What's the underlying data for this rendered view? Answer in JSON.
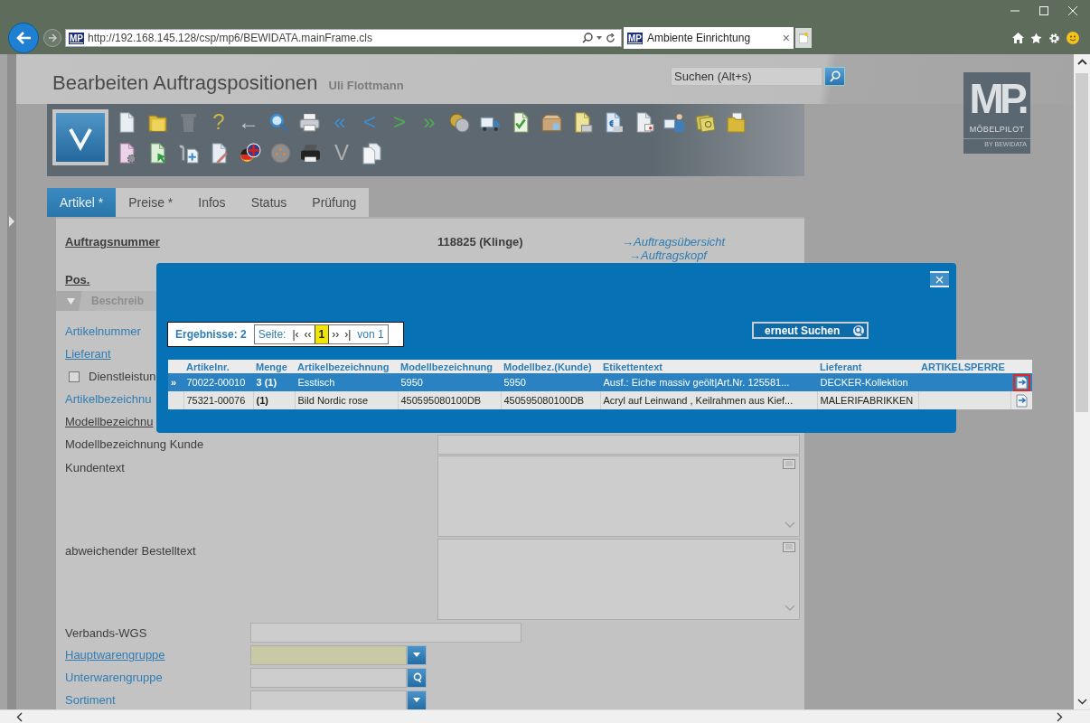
{
  "browser": {
    "site_badge": "MP",
    "url": "http://192.168.145.128/csp/mp6/BEWIDATA.mainFrame.cls",
    "tab": {
      "badge": "MP",
      "title": "Ambiente Einrichtung",
      "close": "×"
    }
  },
  "header": {
    "title": "Bearbeiten Auftragspositionen",
    "user": "Uli Flottmann",
    "search": {
      "placeholder": "Suchen (Alt+s)"
    }
  },
  "logo": {
    "mark": "MP.",
    "name": "MÖBELPILOT",
    "tagline": "BY BEWIDATA"
  },
  "toolbar": {
    "rows": [
      [
        {
          "kind": "document"
        },
        {
          "kind": "folder"
        },
        {
          "kind": "trash"
        },
        {
          "kind": "glyph",
          "text": "?",
          "color": "#c9b740"
        },
        {
          "kind": "glyph",
          "text": "←",
          "color": "#c8c8c8"
        },
        {
          "kind": "magnifier"
        },
        {
          "kind": "printer"
        },
        {
          "kind": "glyph",
          "text": "«",
          "color": "#3f8fd0"
        },
        {
          "kind": "glyph",
          "text": "<",
          "color": "#3f8fd0"
        },
        {
          "kind": "glyph",
          "text": ">",
          "color": "#4fae4f"
        },
        {
          "kind": "glyph",
          "text": "»",
          "color": "#4fae4f"
        },
        {
          "kind": "coins"
        },
        {
          "kind": "truck"
        },
        {
          "kind": "document-check"
        },
        {
          "kind": "package"
        },
        {
          "kind": "document-printer"
        },
        {
          "kind": "document-euro"
        },
        {
          "kind": "document-envelope"
        },
        {
          "kind": "truck-person"
        },
        {
          "kind": "money"
        },
        {
          "kind": "folder-documents"
        }
      ],
      [
        {
          "kind": "document-gear"
        },
        {
          "kind": "document-cursor"
        },
        {
          "kind": "wrench-document"
        },
        {
          "kind": "document-pen"
        },
        {
          "kind": "flag-bubble"
        },
        {
          "kind": "disc"
        },
        {
          "kind": "printer-dark"
        },
        {
          "kind": "glyph",
          "text": "V",
          "color": "#b0b0b0"
        },
        {
          "kind": "documents"
        }
      ]
    ]
  },
  "tabs": [
    {
      "label": "Artikel *",
      "selected": true
    },
    {
      "label": "Preise *",
      "selected": false
    },
    {
      "label": "Infos",
      "selected": false
    },
    {
      "label": "Status",
      "selected": false
    },
    {
      "label": "Prüfung",
      "selected": false
    }
  ],
  "form": {
    "order": {
      "label": "Auftragsnummer",
      "value": "118825 (Klinge)",
      "links": [
        "→Auftragsübersicht",
        "→Auftragskopf"
      ]
    },
    "position": {
      "label": "Pos."
    },
    "section": {
      "title": "Beschreib",
      "expanded": true
    },
    "fields": [
      {
        "label": "Artikelnummer",
        "kind": "none"
      },
      {
        "label": "Lieferant",
        "kind": "none"
      },
      {
        "label": "Dienstleistun",
        "kind": "checkbox",
        "checked": false
      },
      {
        "label": "Artikelbezeichnu",
        "kind": "none"
      },
      {
        "label": "Modellbezeichnu",
        "kind": "none"
      },
      {
        "label": "Modellbezeichnung Kunde",
        "kind": "wide-text"
      },
      {
        "label": "Kundentext",
        "kind": "textarea"
      },
      {
        "label": "abweichender Bestelltext",
        "kind": "textarea"
      },
      {
        "label": "Verbands-WGS",
        "kind": "text",
        "mandatory": false
      },
      {
        "label": "Hauptwarengruppe",
        "kind": "select",
        "mandatory": true
      },
      {
        "label": "Unterwarengruppe",
        "kind": "lookup",
        "mandatory": false
      },
      {
        "label": "Sortiment",
        "kind": "select",
        "mandatory": false
      }
    ]
  },
  "search_dialog": {
    "results": "Ergebnisse: 2",
    "pager": {
      "label": "Seite:",
      "first": "|‹",
      "prev": "‹‹",
      "page": "1",
      "next": "››",
      "last": "›|",
      "total": "von 1"
    },
    "search_again": "erneut Suchen",
    "columns": [
      "Artikelnr.",
      "Menge",
      "Artikelbezeichnung",
      "Modellbezeichnung",
      "Modellbez.(Kunde)",
      "Etikettentext",
      "Lieferant",
      "ARTIKELSPERRE"
    ],
    "rows": [
      {
        "selected": true,
        "marker": "»",
        "highlighted": true,
        "cells": [
          "70022-00010",
          "3 (1)",
          "Esstisch",
          "5950",
          "5950",
          "Ausf.: Eiche massiv geölt|Art.Nr. 125581...",
          "DECKER-Kollektion"
        ]
      },
      {
        "selected": false,
        "highlighted": false,
        "cells": [
          "75321-00076",
          "(1)",
          "Bild Nordic rose",
          "450595080100DB",
          "450595080100DB",
          "Acryl auf Leinwand , Keilrahmen aus Kief...",
          "MALERIFABRIKKEN"
        ]
      }
    ]
  }
}
